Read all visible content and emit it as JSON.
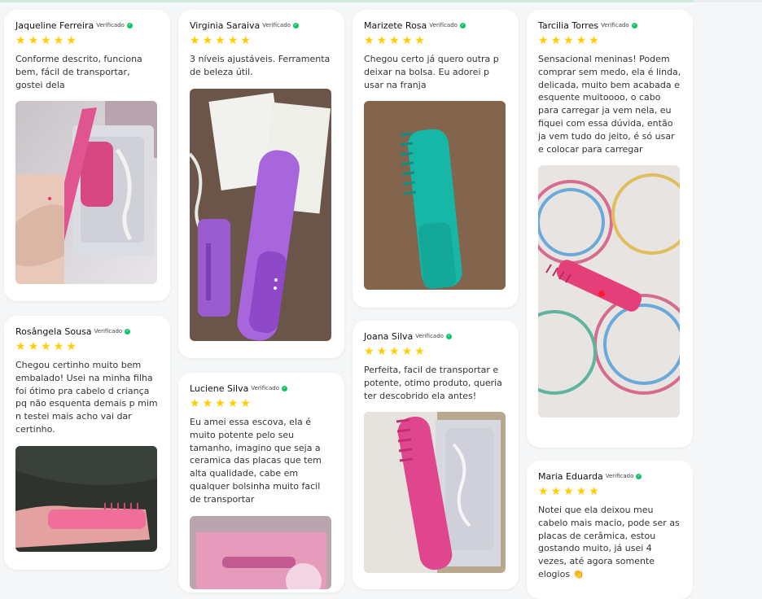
{
  "verified_label": "Verificado",
  "reviews": [
    {
      "name": "Jaqueline Ferreira",
      "text": "Conforme descrito, funciona bem, fácil de transportar, gostei dela",
      "rating": 5
    },
    {
      "name": "Rosângela Sousa",
      "text": "Chegou certinho muito bem embalado! Usei na minha filha foi ótimo pra cabelo d criança pq não esquenta demais p mim n testei mais acho vai dar certinho.",
      "rating": 5
    },
    {
      "name": "Virginia Saraiva",
      "text": "3 níveis ajustáveis. Ferramenta de beleza útil.",
      "rating": 5
    },
    {
      "name": "Luciene Silva",
      "text": "Eu amei essa escova, ela é muito potente pelo seu tamanho, imagino que seja a ceramica das placas que tem alta qualidade, cabe em qualquer bolsinha muito facil de transportar",
      "rating": 5
    },
    {
      "name": "Marizete Rosa",
      "text": "Chegou certo já quero outra p deixar na bolsa. Eu adorei p usar na franja",
      "rating": 5
    },
    {
      "name": "Joana Silva",
      "text": "Perfeita, facil de transportar e potente, otimo produto, queria ter descobrido ela antes!",
      "rating": 5
    },
    {
      "name": "Tarcilia Torres",
      "text": "Sensacional meninas! Podem comprar sem medo, ela é linda, delicada, muito bem acabada e esquente muitoooo, o cabo para carregar ja vem nela, eu fiquei com essa dúvida, então ja vem tudo do jeito, é só usar e colocar para carregar",
      "rating": 5
    },
    {
      "name": "Maria Eduarda",
      "text": "Notei que ela deixou meu cabelo mais macio, pode ser as placas de cerâmica, estou gostando muito, já usei 4 vezes, até agora somente elogios 👏",
      "rating": 5
    }
  ],
  "colors": {
    "star": "#ffce00",
    "verified": "#10c36b"
  }
}
